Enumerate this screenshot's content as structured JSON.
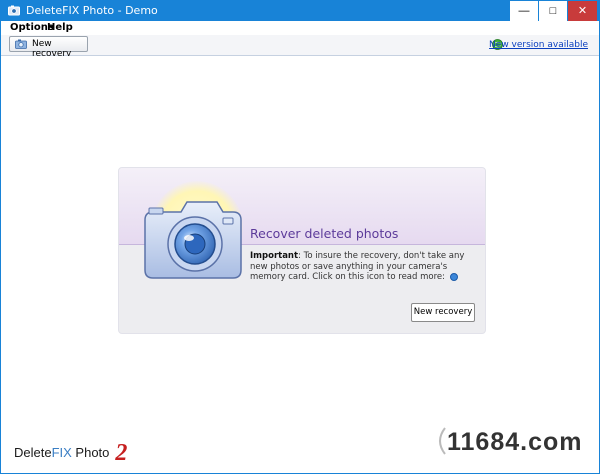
{
  "window": {
    "title": "DeleteFIX Photo - Demo",
    "controls": {
      "minimize": "—",
      "maximize": "□",
      "close": "✕"
    }
  },
  "menu": {
    "items": [
      "Options",
      "Help"
    ]
  },
  "toolbar": {
    "new_recovery_label": "New recovery",
    "new_version_label": "New version available"
  },
  "card": {
    "title": "Recover deleted photos",
    "important_label": "Important",
    "important_text": ": To insure the recovery, don't take any new photos or save anything in your camera's memory card. Click on this icon to read more:",
    "button_label": "New recovery"
  },
  "footer": {
    "logo_prefix": "Delete",
    "logo_fix": "FIX",
    "logo_suffix": " Photo",
    "logo_version": "2"
  },
  "watermark": "11684.com",
  "colors": {
    "titlebar": "#1883d7",
    "card_title": "#5c3b9a",
    "link": "#0a3fbf",
    "logo_version": "#c61f1f"
  },
  "icons": {
    "app": "camera-app-icon",
    "toolbar_button": "recovery-icon",
    "new_version": "update-globe-icon",
    "info": "info-icon",
    "hero": "camera-icon"
  }
}
